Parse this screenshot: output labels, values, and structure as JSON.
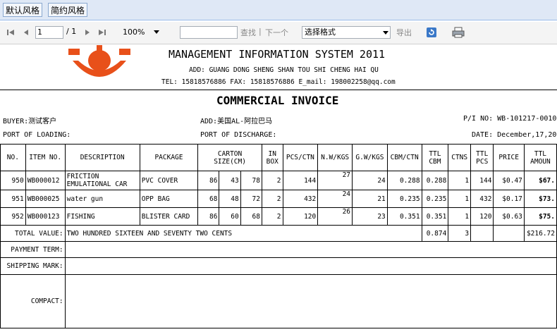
{
  "style_buttons": {
    "default": "默认风格",
    "simple": "简约风格"
  },
  "toolbar": {
    "page_input": "1",
    "page_total": "/ 1",
    "zoom": "100%",
    "find_label": "查找",
    "sep": "|",
    "next_label": "下一个",
    "format_select": "选择格式",
    "export_label": "导出"
  },
  "header": {
    "title": "MANAGEMENT INFORMATION SYSTEM 2011",
    "address": "ADD: GUANG DONG SHENG SHAN TOU SHI CHENG HAI QU",
    "contact": "TEL: 15818576886  FAX: 15818576886  E_mail: 198002258@qq.com",
    "doc_title": "COMMERCIAL INVOICE"
  },
  "info": {
    "buyer": "BUYER:测试客户",
    "add": "ADD:美国AL-阿拉巴马",
    "pi": "P/I NO: WB-101217-0010",
    "port_loading": "PORT OF LOADING:",
    "port_discharge": "PORT OF DISCHARGE:",
    "date": "DATE: December,17,20"
  },
  "columns": {
    "no": "NO.",
    "item": "ITEM NO.",
    "desc": "DESCRIPTION",
    "pkg": "PACKAGE",
    "carton1": "CARTON",
    "carton2": "SIZE(CM)",
    "inbox1": "IN",
    "inbox2": "BOX",
    "pcs_ctn": "PCS/CTN",
    "nw": "N.W/KGS",
    "gw": "G.W/KGS",
    "cbm_ctn": "CBM/CTN",
    "ttl_cbm1": "TTL",
    "ttl_cbm2": "CBM",
    "ctns": "CTNS",
    "ttl_pcs1": "TTL",
    "ttl_pcs2": "PCS",
    "price": "PRICE",
    "amount1": "TTL",
    "amount2": "AMOUN"
  },
  "rows": [
    {
      "no": "950",
      "item": "WB000012",
      "desc1": "FRICTION",
      "desc2": "EMULATIONAL CAR",
      "pkg": "PVC COVER",
      "l": "86",
      "w": "43",
      "h": "78",
      "inbox": "2",
      "pcs_ctn": "144",
      "nw": "27",
      "gw": "24",
      "cbm_ctn": "0.288",
      "ttl_cbm": "0.288",
      "ctns": "1",
      "ttl_pcs": "144",
      "price": "$0.47",
      "amount": "$67."
    },
    {
      "no": "951",
      "item": "WB000025",
      "desc1": "water gun",
      "desc2": "",
      "pkg": "OPP BAG",
      "l": "68",
      "w": "48",
      "h": "72",
      "inbox": "2",
      "pcs_ctn": "432",
      "nw": "24",
      "gw": "21",
      "cbm_ctn": "0.235",
      "ttl_cbm": "0.235",
      "ctns": "1",
      "ttl_pcs": "432",
      "price": "$0.17",
      "amount": "$73."
    },
    {
      "no": "952",
      "item": "WB000123",
      "desc1": "FISHING",
      "desc2": "",
      "pkg": "BLISTER CARD",
      "l": "86",
      "w": "60",
      "h": "68",
      "inbox": "2",
      "pcs_ctn": "120",
      "nw": "26",
      "gw": "23",
      "cbm_ctn": "0.351",
      "ttl_cbm": "0.351",
      "ctns": "1",
      "ttl_pcs": "120",
      "price": "$0.63",
      "amount": "$75."
    }
  ],
  "total": {
    "label": "TOTAL VALUE:",
    "words": "TWO HUNDRED SIXTEEN AND SEVENTY TWO CENTS",
    "ttl_cbm": "0.874",
    "ctns": "3",
    "amount": "$216.72"
  },
  "footer": {
    "payment": "PAYMENT TERM:",
    "shipping": "SHIPPING MARK:",
    "compact": "COMPACT:"
  },
  "colors": {
    "logo": "#e8501a",
    "topbar": "#dfe8f6"
  }
}
